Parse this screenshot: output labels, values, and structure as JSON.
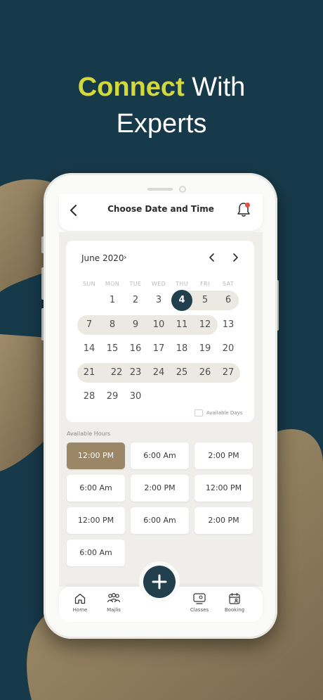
{
  "headline": {
    "accent": "Connect",
    "rest": "With",
    "line2": "Experts"
  },
  "screen_title": "Choose Date and Time",
  "calendar": {
    "month_label": "June 2020",
    "month_caret": "›",
    "weekdays": [
      "SUN",
      "MON",
      "TUE",
      "WED",
      "THU",
      "FRI",
      "SAT"
    ],
    "days": [
      "1",
      "2",
      "3",
      "4",
      "5",
      "6",
      "7",
      "8",
      "9",
      "10",
      "11",
      "12",
      "13",
      "14",
      "15",
      "16",
      "17",
      "18",
      "19",
      "20",
      "21",
      "22",
      "23",
      "24",
      "25",
      "26",
      "27",
      "28",
      "29",
      "30"
    ],
    "selected_day": "4",
    "available_days_label": "Available Days"
  },
  "hours": {
    "label": "Available Hours",
    "slots": [
      "12:00 PM",
      "6:00 Am",
      "2:00 PM",
      "6:00 Am",
      "2:00 PM",
      "12:00 PM",
      "12:00 PM",
      "6:00 Am",
      "2:00 PM",
      "6:00 Am"
    ],
    "selected_slot": "12:00 PM"
  },
  "nav": {
    "home": "Home",
    "majlis": "Majlis",
    "classes": "Classes",
    "booking": "Booking"
  },
  "icons": [
    "back-icon",
    "bell-icon",
    "chevron-left-icon",
    "chevron-right-icon",
    "plus-icon",
    "home-icon",
    "majlis-icon",
    "classes-icon",
    "booking-icon"
  ],
  "colors": {
    "background": "#173a4a",
    "accent_text": "#d3d93c",
    "blob": "#8c7a5b",
    "selected_day": "#213f4d",
    "selected_slot": "#9b8666",
    "notification_dot": "#e94b3c"
  }
}
